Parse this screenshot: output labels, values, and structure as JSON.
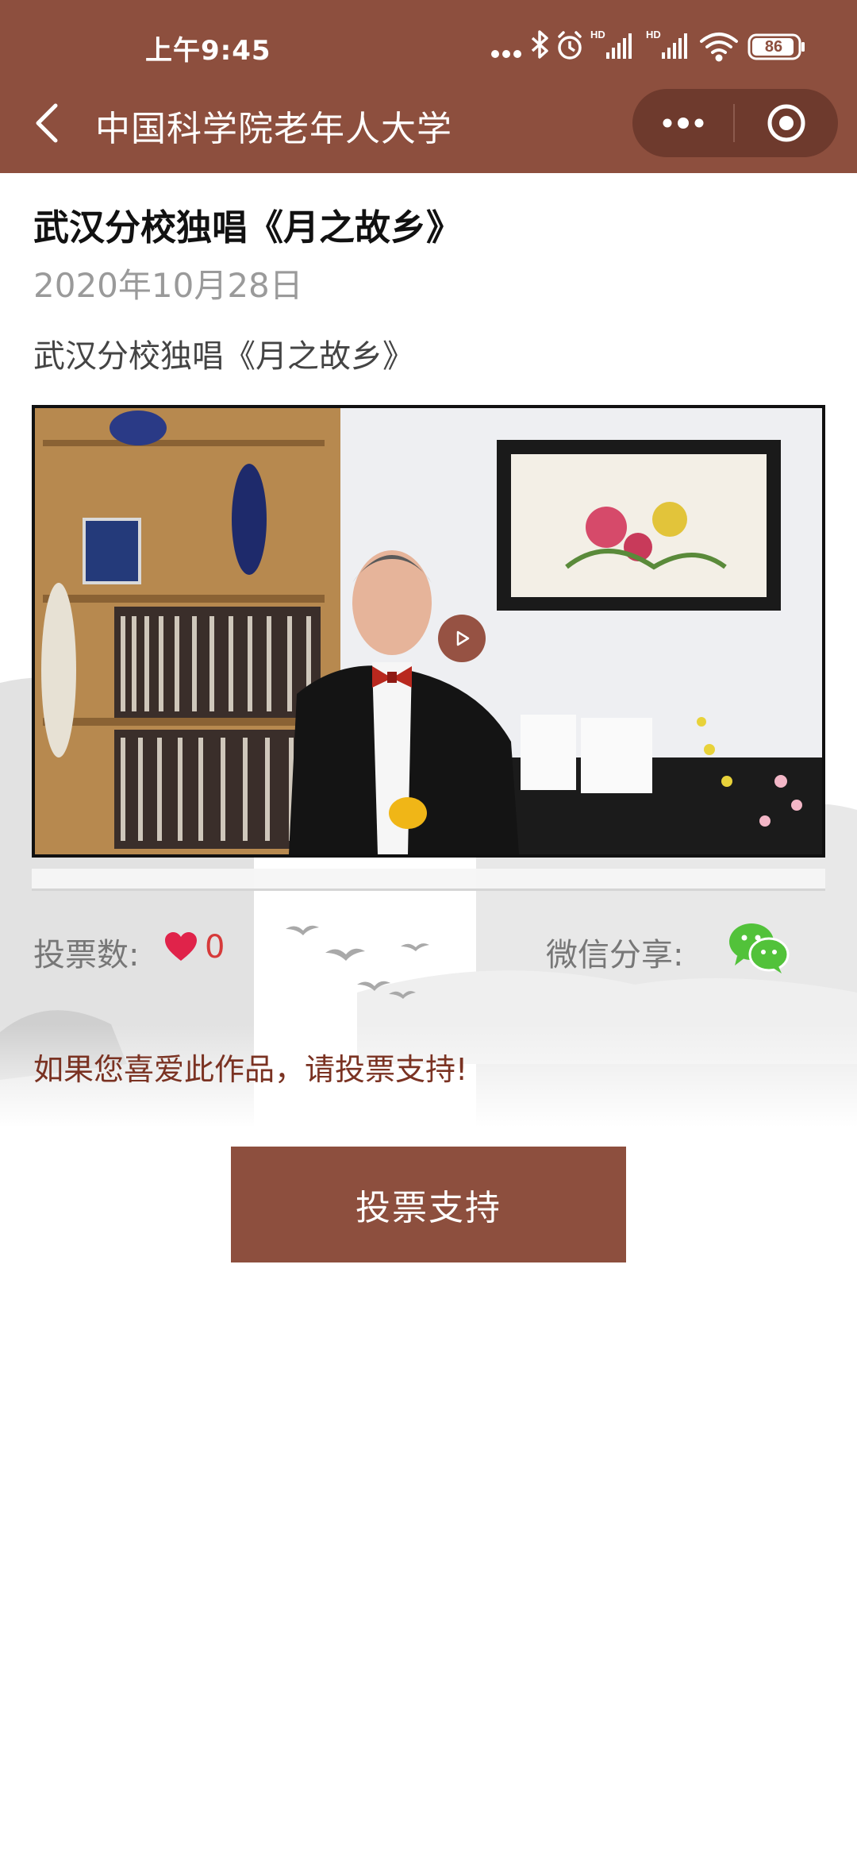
{
  "status_bar": {
    "time": "上午9:45",
    "battery": "86",
    "icons": [
      "more-dots-icon",
      "bluetooth-icon",
      "alarm-icon",
      "signal-hd-icon",
      "signal-hd-icon",
      "wifi-icon",
      "battery-icon"
    ]
  },
  "nav": {
    "title": "中国科学院老年人大学",
    "back_icon": "chevron-left-icon",
    "menu_icon": "more-dots-icon",
    "close_icon": "target-circle-icon"
  },
  "post": {
    "title": "武汉分校独唱《月之故乡》",
    "date": "2020年10月28日",
    "description": "武汉分校独唱《月之故乡》"
  },
  "video": {
    "play_icon": "play-icon"
  },
  "votes": {
    "label": "投票数:",
    "count": "0",
    "heart_icon": "heart-icon"
  },
  "share": {
    "label": "微信分享:",
    "icon": "wechat-icon"
  },
  "support_prompt": "如果您喜爱此作品，请投票支持!",
  "vote_button": "投票支持",
  "colors": {
    "brand_brown": "#8d4f3e",
    "capsule_brown": "#6e3a2d",
    "heart_red": "#e0234a",
    "count_red": "#d63a3a",
    "prompt_brown": "#7a3222",
    "wechat_green": "#52c23a"
  }
}
